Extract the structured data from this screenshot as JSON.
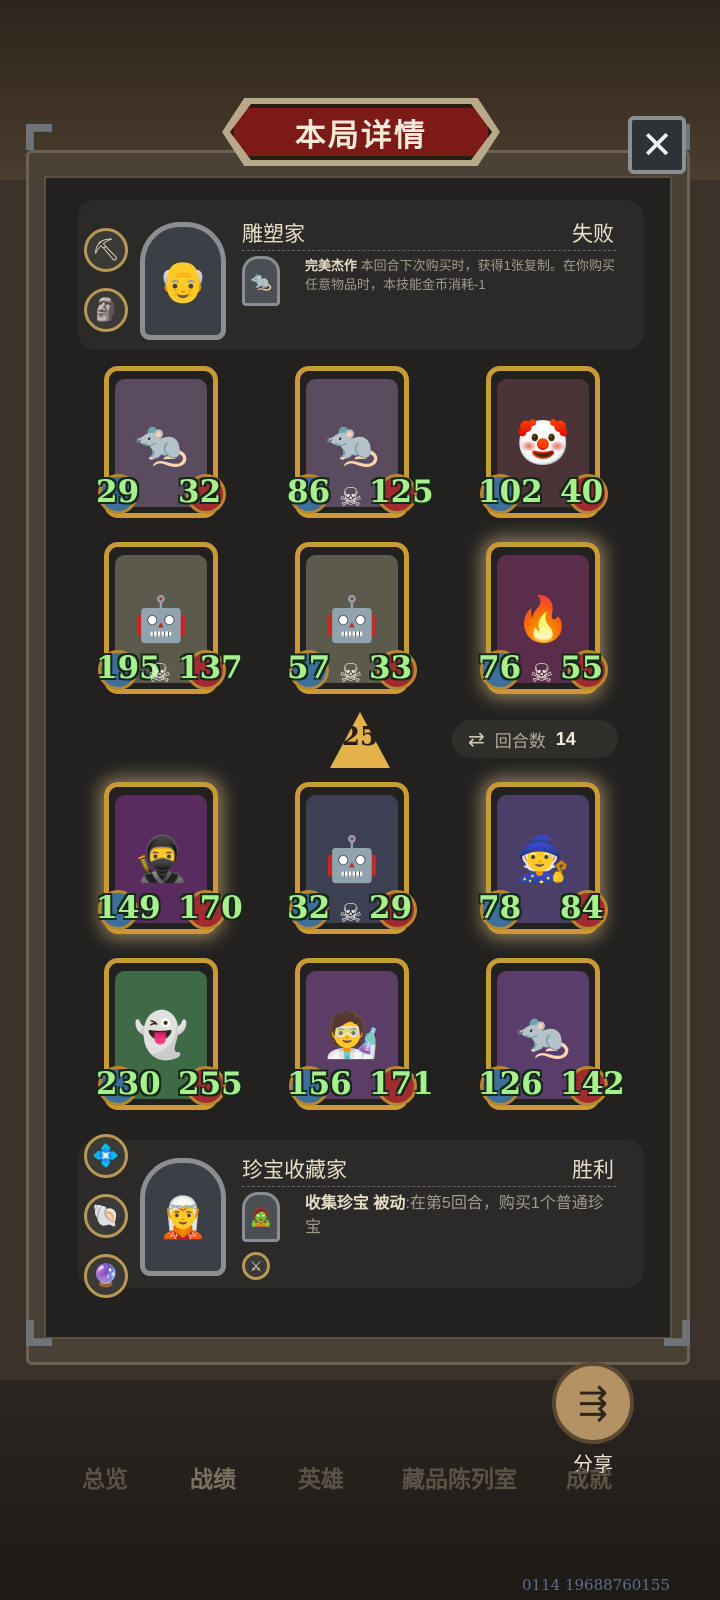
{
  "dialog": {
    "title": "本局详情",
    "close_symbol": "✕"
  },
  "player1": {
    "name": "雕塑家",
    "result": "失败",
    "relic_icons": [
      "pickaxe-icon",
      "statue-icon"
    ],
    "skill_name": "完美杰作",
    "skill_desc": "本回合下次购买时，获得1张复制。在你购买任意物品时，本技能金币消耗-1"
  },
  "board": {
    "level": "25",
    "round_label": "回合数",
    "round_value": "14",
    "cards": [
      {
        "name": "rat-bandit",
        "atk": "29",
        "hp": "32",
        "skull": false,
        "glow": false,
        "art_color": "#5a4b5e",
        "glyph": "🐀"
      },
      {
        "name": "rat-bandit",
        "atk": "86",
        "hp": "125",
        "skull": true,
        "glow": false,
        "art_color": "#5a4b5e",
        "glyph": "🐀"
      },
      {
        "name": "clown",
        "atk": "102",
        "hp": "40",
        "skull": false,
        "glow": false,
        "art_color": "#4a3438",
        "glyph": "🤡"
      },
      {
        "name": "robot-octopus",
        "atk": "195",
        "hp": "137",
        "skull": true,
        "glow": false,
        "art_color": "#5b5a4d",
        "glyph": "🤖"
      },
      {
        "name": "robot-octopus",
        "atk": "57",
        "hp": "33",
        "skull": true,
        "glow": false,
        "art_color": "#5b5a4d",
        "glyph": "🤖"
      },
      {
        "name": "phoenix",
        "atk": "76",
        "hp": "55",
        "skull": true,
        "glow": true,
        "art_color": "#5a2d4a",
        "glyph": "🔥"
      },
      {
        "name": "hooded-assassin",
        "atk": "149",
        "hp": "170",
        "skull": false,
        "glow": true,
        "art_color": "#5a2b5e",
        "glyph": "🥷"
      },
      {
        "name": "robot-octopus",
        "atk": "32",
        "hp": "29",
        "skull": true,
        "glow": false,
        "art_color": "#3d3f52",
        "glyph": "🤖"
      },
      {
        "name": "young-wizard",
        "atk": "78",
        "hp": "84",
        "skull": false,
        "glow": true,
        "art_color": "#4b3f6a",
        "glyph": "🧙"
      },
      {
        "name": "green-ghost",
        "atk": "230",
        "hp": "255",
        "skull": false,
        "glow": false,
        "art_color": "#3e6b46",
        "glyph": "👻"
      },
      {
        "name": "cyborg-scientist",
        "atk": "156",
        "hp": "171",
        "skull": false,
        "glow": false,
        "art_color": "#5b3d66",
        "glyph": "🧑‍🔬"
      },
      {
        "name": "rat-bandit",
        "atk": "126",
        "hp": "142",
        "skull": false,
        "glow": false,
        "art_color": "#5a3d6a",
        "glyph": "🐀"
      }
    ]
  },
  "player2": {
    "name": "珍宝收藏家",
    "result": "胜利",
    "relic_icons": [
      "treasure-icon",
      "shell-icon",
      "crystal-icon"
    ],
    "skill_name": "收集珍宝",
    "skill_type": "被动",
    "skill_desc": ":在第5回合，购买1个普通珍宝"
  },
  "share": {
    "label": "分享"
  },
  "nav": {
    "tabs": [
      "总览",
      "战绩",
      "英雄",
      "藏品陈列室",
      "成就"
    ],
    "active": "战绩"
  },
  "uid": "0114 19688760155"
}
